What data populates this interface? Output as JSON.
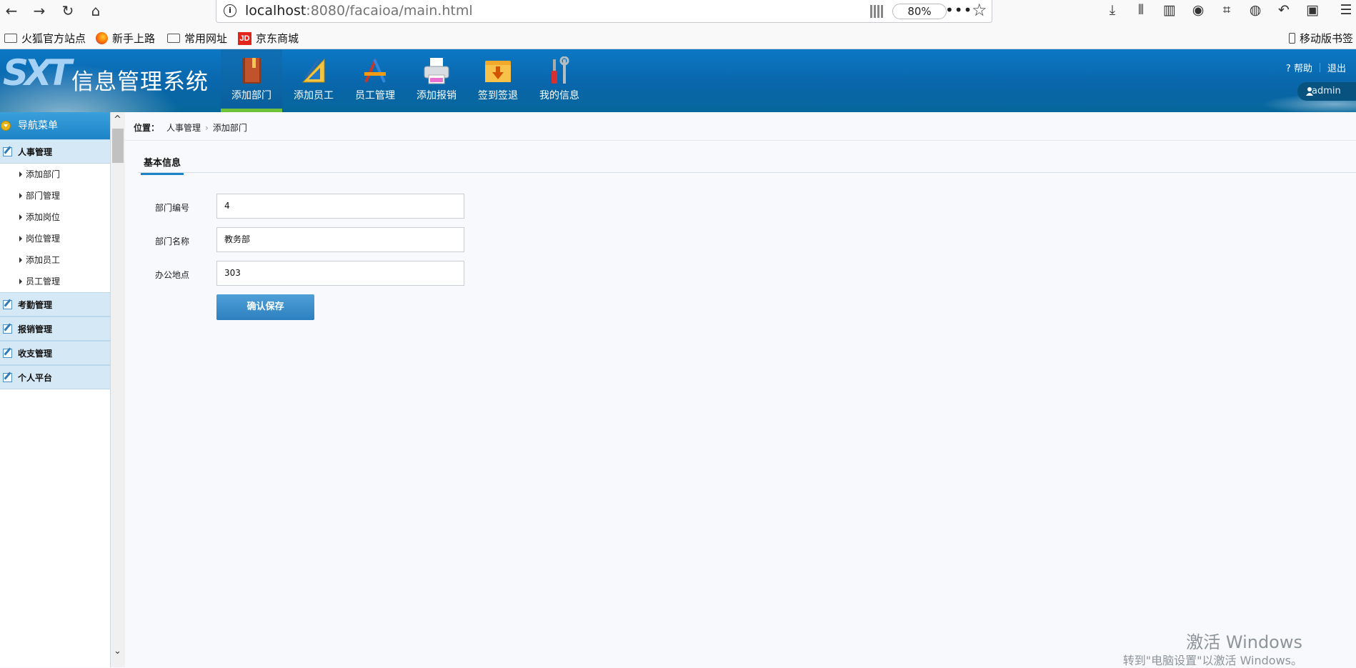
{
  "browser": {
    "url_host": "localhost",
    "url_path": ":8080/facaioa/main.html",
    "zoom": "80%",
    "bookmarks": [
      "火狐官方站点",
      "新手上路",
      "常用网址",
      "京东商城"
    ],
    "mobile_bookmarks": "移动版书签"
  },
  "header": {
    "title": "信息管理系统",
    "nav": [
      "添加部门",
      "添加员工",
      "员工管理",
      "添加报销",
      "签到签退",
      "我的信息"
    ],
    "help": "帮助",
    "logout": "退出",
    "user": "admin"
  },
  "sidebar": {
    "heading": "导航菜单",
    "groups": [
      "人事管理",
      "考勤管理",
      "报销管理",
      "收支管理",
      "个人平台"
    ],
    "sub_items": [
      "添加部门",
      "部门管理",
      "添加岗位",
      "岗位管理",
      "添加员工",
      "员工管理"
    ]
  },
  "main": {
    "breadcrumb_label": "位置：",
    "breadcrumb": [
      "人事管理",
      "添加部门"
    ],
    "tab": "基本信息",
    "fields": [
      {
        "label": "部门编号",
        "value": "4"
      },
      {
        "label": "部门名称",
        "value": "教务部"
      },
      {
        "label": "办公地点",
        "value": "303"
      }
    ],
    "save_label": "确认保存"
  },
  "watermark": {
    "line1": "激活 Windows",
    "line2": "转到\"电脑设置\"以激活 Windows。"
  }
}
